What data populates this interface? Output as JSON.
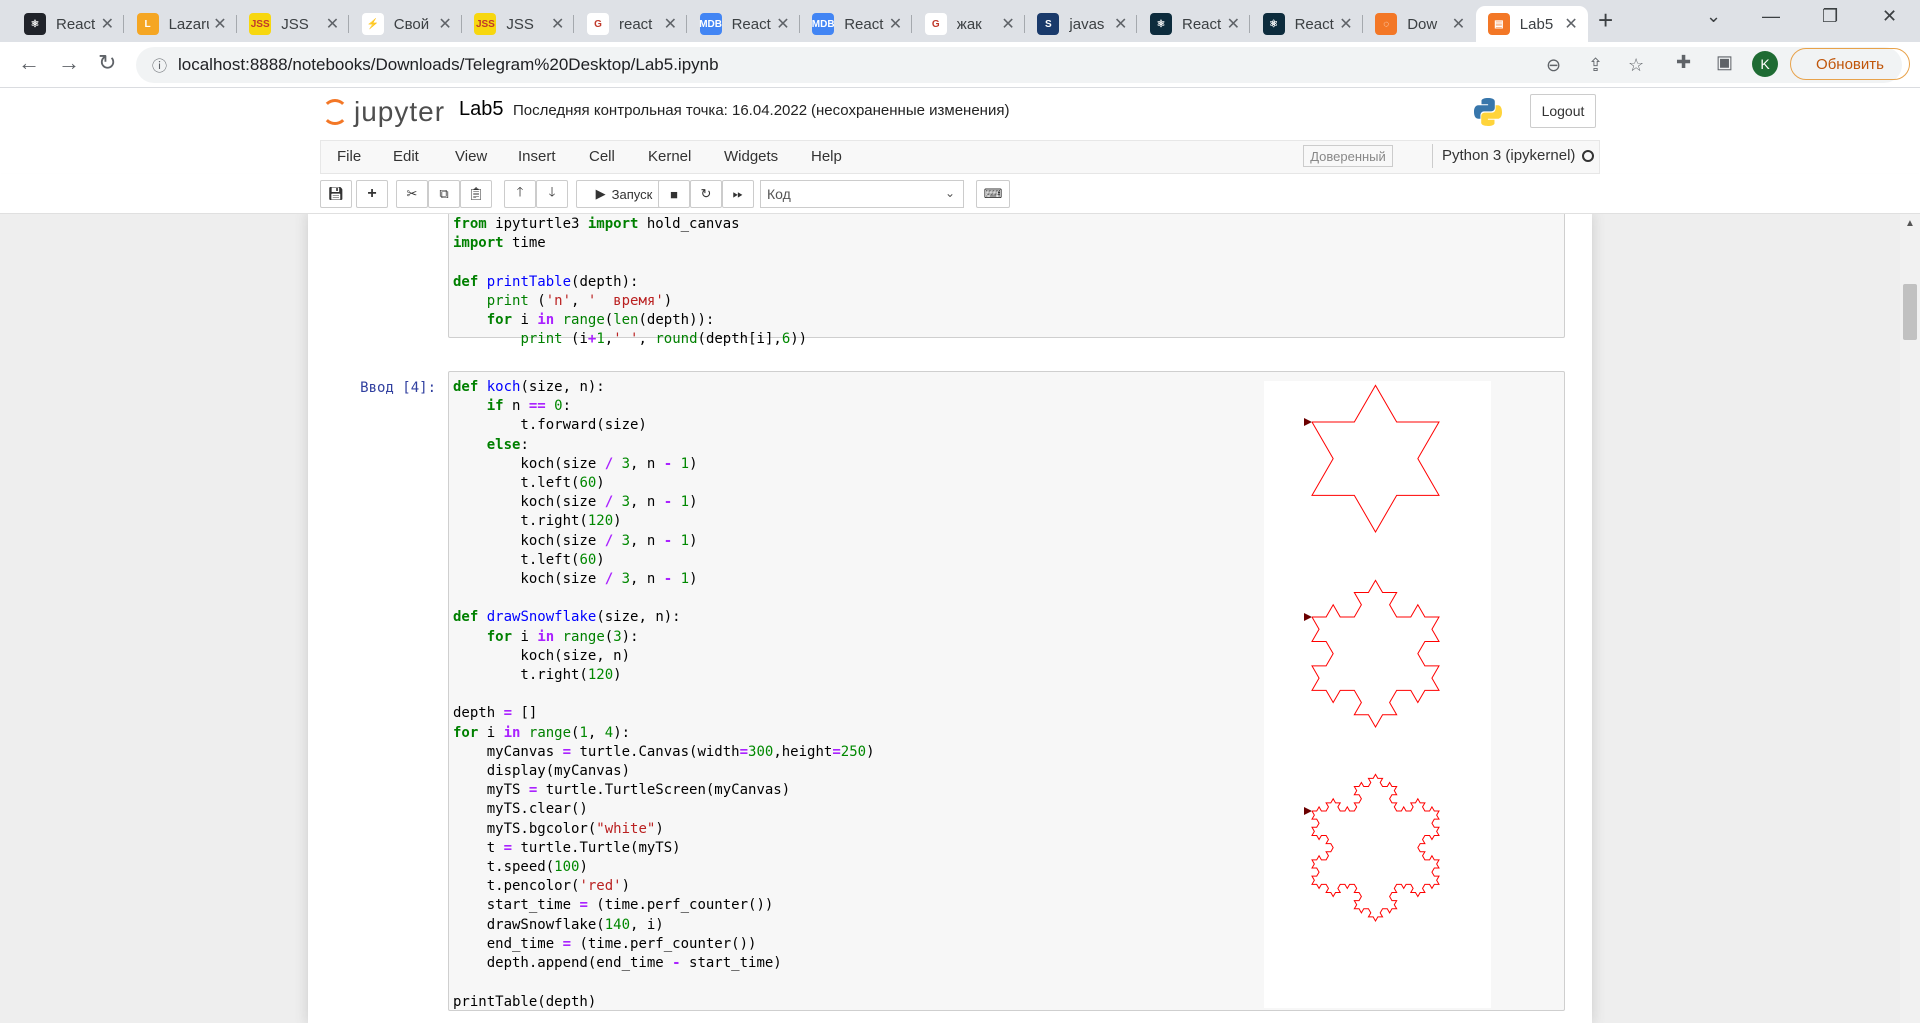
{
  "browser": {
    "tabs": [
      {
        "title": "React",
        "fav_color": "#20232a",
        "fav_text": "⚛"
      },
      {
        "title": "Lazarus",
        "fav_color": "#f5a623",
        "fav_text": "L"
      },
      {
        "title": "JSS",
        "fav_color": "#f7d70f",
        "fav_text": "JSS"
      },
      {
        "title": "Свой",
        "fav_color": "#ffffff",
        "fav_text": "⚡"
      },
      {
        "title": "JSS",
        "fav_color": "#f7d70f",
        "fav_text": "JSS"
      },
      {
        "title": "react",
        "fav_color": "#ffffff",
        "fav_text": "G"
      },
      {
        "title": "React",
        "fav_color": "#4285f4",
        "fav_text": "MDB"
      },
      {
        "title": "React",
        "fav_color": "#4285f4",
        "fav_text": "MDB"
      },
      {
        "title": "жак",
        "fav_color": "#ffffff",
        "fav_text": "G"
      },
      {
        "title": "javas",
        "fav_color": "#1a3a6b",
        "fav_text": "S"
      },
      {
        "title": "React",
        "fav_color": "#0d2c3d",
        "fav_text": "⚛"
      },
      {
        "title": "React",
        "fav_color": "#0d2c3d",
        "fav_text": "⚛"
      },
      {
        "title": "Dow",
        "fav_color": "#f37726",
        "fav_text": "◌"
      },
      {
        "title": "Lab5",
        "fav_color": "#f37726",
        "fav_text": "▤"
      }
    ],
    "url": "localhost:8888/notebooks/Downloads/Telegram%20Desktop/Lab5.ipynb",
    "profile_initial": "K",
    "update_label": "Обновить"
  },
  "jupyter": {
    "logo_text": "jupyter",
    "notebook_name": "Lab5",
    "checkpoint": "Последняя контрольная точка: 16.04.2022",
    "unsaved": "(несохраненные изменения)",
    "logout_label": "Logout",
    "menu": [
      "File",
      "Edit",
      "View",
      "Insert",
      "Cell",
      "Kernel",
      "Widgets",
      "Help"
    ],
    "trusted_label": "Доверенный",
    "kernel_name": "Python 3 (ipykernel)",
    "run_label": "Запуск",
    "cell_type": "Код"
  },
  "cells": [
    {
      "prompt": "",
      "lines_visible": 7
    },
    {
      "prompt": "Ввод [4]:"
    }
  ],
  "output": {
    "stroke_color": "#ff0000",
    "snowflakes": [
      {
        "iterations": 1
      },
      {
        "iterations": 2
      },
      {
        "iterations": 3
      }
    ]
  }
}
